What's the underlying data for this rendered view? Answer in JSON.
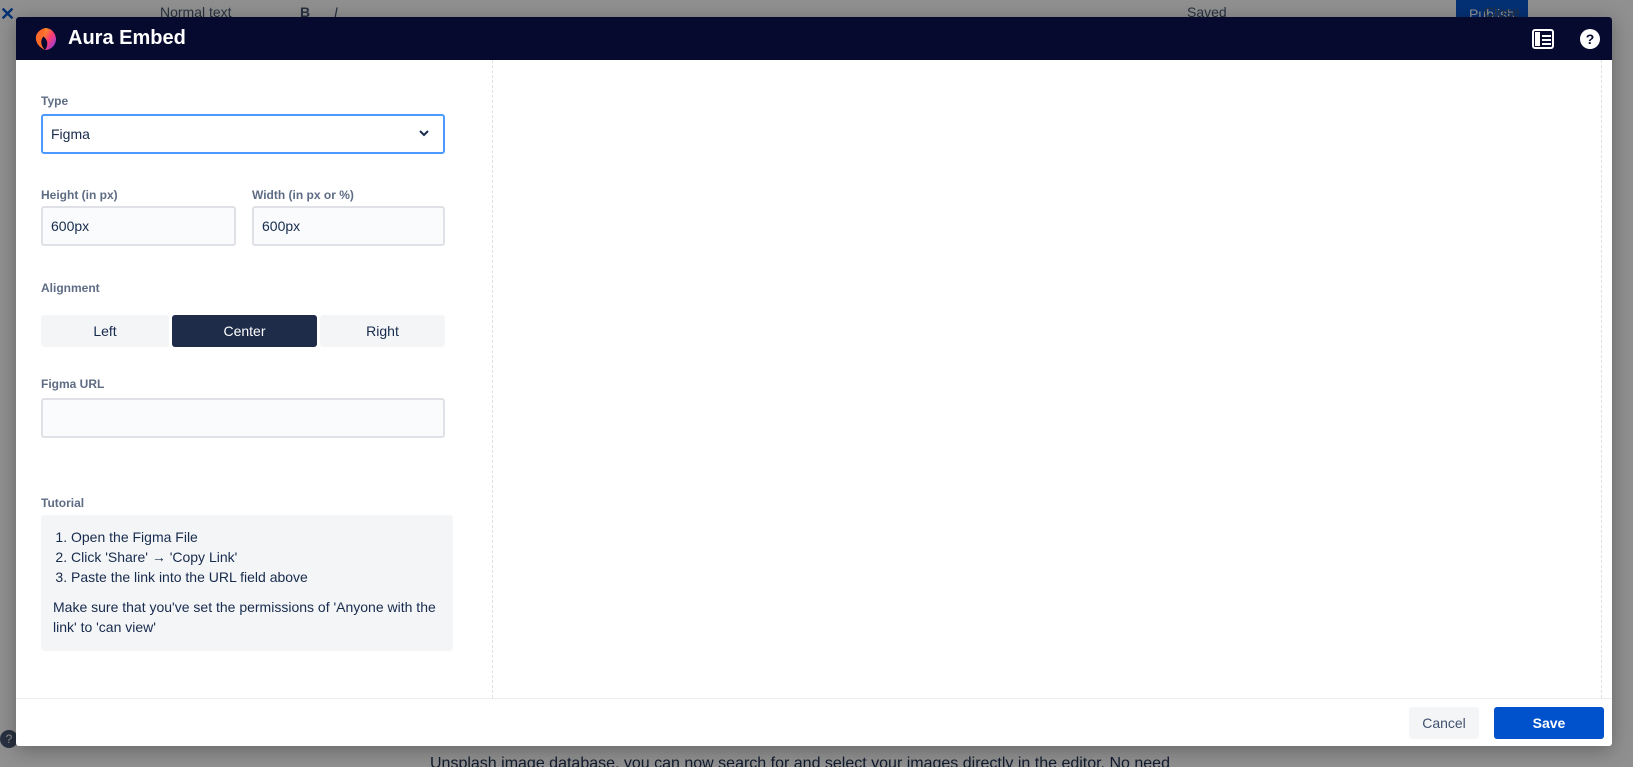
{
  "background": {
    "toolbar": {
      "text_style": "Normal text",
      "saved_label": "Saved",
      "publish_label": "Publish",
      "close_label": "Close"
    },
    "body_text": "Unsplash image database, you can now search for and select your images directly in the editor. No need"
  },
  "modal": {
    "title": "Aura Embed",
    "header_icons": [
      "table-icon",
      "help-icon"
    ],
    "type": {
      "label": "Type",
      "value": "Figma"
    },
    "height": {
      "label": "Height (in px)",
      "value": "600px"
    },
    "width": {
      "label": "Width (in px or %)",
      "value": "600px"
    },
    "alignment": {
      "label": "Alignment",
      "options": [
        "Left",
        "Center",
        "Right"
      ],
      "selected": "Center"
    },
    "url": {
      "label": "Figma URL",
      "value": "",
      "placeholder": ""
    },
    "tutorial": {
      "label": "Tutorial",
      "steps": [
        "Open the Figma File",
        "Click 'Share' → 'Copy Link'",
        "Paste the link into the URL field above"
      ],
      "note": "Make sure that you've set the permissions of 'Anyone with the link' to 'can view'"
    },
    "footer": {
      "cancel_label": "Cancel",
      "save_label": "Save"
    }
  },
  "colors": {
    "header_bg": "#060a2e",
    "primary": "#0052cc",
    "segment_active": "#1e2c4a",
    "focus_border": "#4c9aff"
  }
}
